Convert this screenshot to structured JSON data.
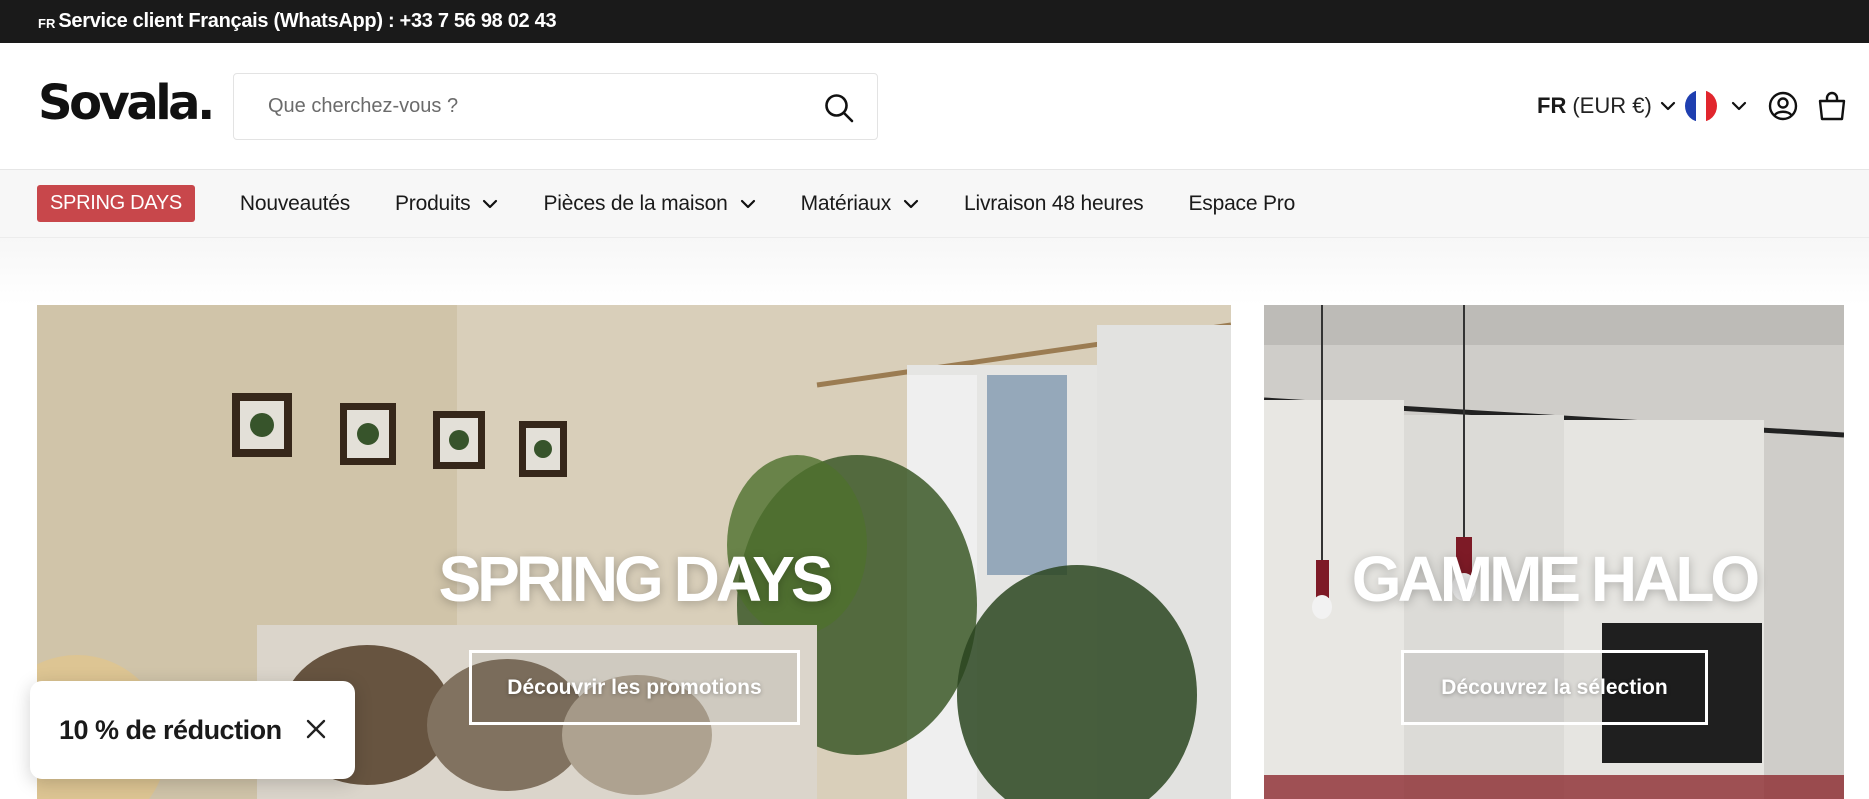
{
  "topbar": {
    "flag_code": "FR",
    "message": "Service client Français (WhatsApp) : +33 7 56 98 02 43"
  },
  "header": {
    "logo": "Sovala.",
    "search": {
      "placeholder": "Que cherchez-vous ?",
      "value": "",
      "icon": "search-icon"
    },
    "locale": {
      "language": "FR",
      "currency": "(EUR €)"
    },
    "country_flag": "france-flag-icon",
    "icons": [
      "account-icon",
      "cart-bag-icon"
    ]
  },
  "nav": {
    "promo_label": "SPRING DAYS",
    "items": [
      {
        "label": "Nouveautés",
        "has_dropdown": false
      },
      {
        "label": "Produits",
        "has_dropdown": true
      },
      {
        "label": "Pièces de la maison",
        "has_dropdown": true
      },
      {
        "label": "Matériaux",
        "has_dropdown": true
      },
      {
        "label": "Livraison 48 heures",
        "has_dropdown": false
      },
      {
        "label": "Espace Pro",
        "has_dropdown": false
      }
    ]
  },
  "banners": [
    {
      "title": "SPRING DAYS",
      "cta": "Découvrir les promotions"
    },
    {
      "title": "GAMME HALO",
      "cta": "Découvrez la sélection"
    }
  ],
  "discount_popup": {
    "text": "10 % de réduction"
  },
  "colors": {
    "topbar_bg": "#1a1a1a",
    "promo_badge": "#c8474b",
    "nav_bg": "#f7f7f7"
  }
}
